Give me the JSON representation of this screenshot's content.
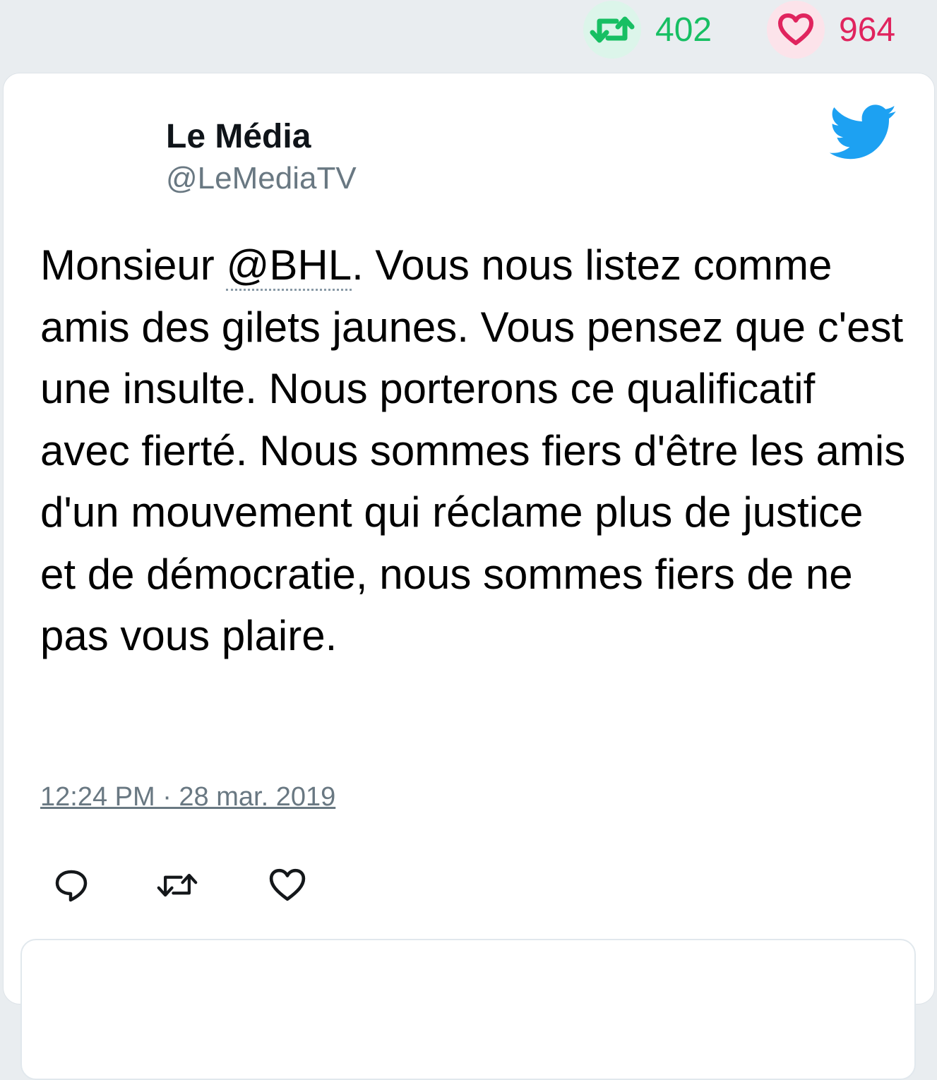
{
  "stats": {
    "retweets": "402",
    "likes": "964",
    "retweet_icon": "retweet-icon",
    "like_icon": "heart-icon"
  },
  "tweet": {
    "author_name": "Le Média",
    "author_handle": "@LeMediaTV",
    "text_before_mention": "Monsieur ",
    "mention": "@BHL",
    "text_after_mention": ". Vous nous listez comme amis des gilets jaunes. Vous pensez que c'est une insulte. Nous porterons ce qualificatif avec fierté. Nous sommes fiers d'être les amis d'un mouvement qui réclame plus de justice et de démocratie, nous sommes fiers de ne pas vous plaire.",
    "timestamp": "12:24 PM · 28 mar. 2019"
  },
  "colors": {
    "retweet_green": "#17bf63",
    "like_red": "#e0245e",
    "twitter_blue": "#1da1f2",
    "muted_gray": "#697882"
  },
  "actions": [
    "reply-icon",
    "retweet-icon",
    "heart-icon"
  ]
}
